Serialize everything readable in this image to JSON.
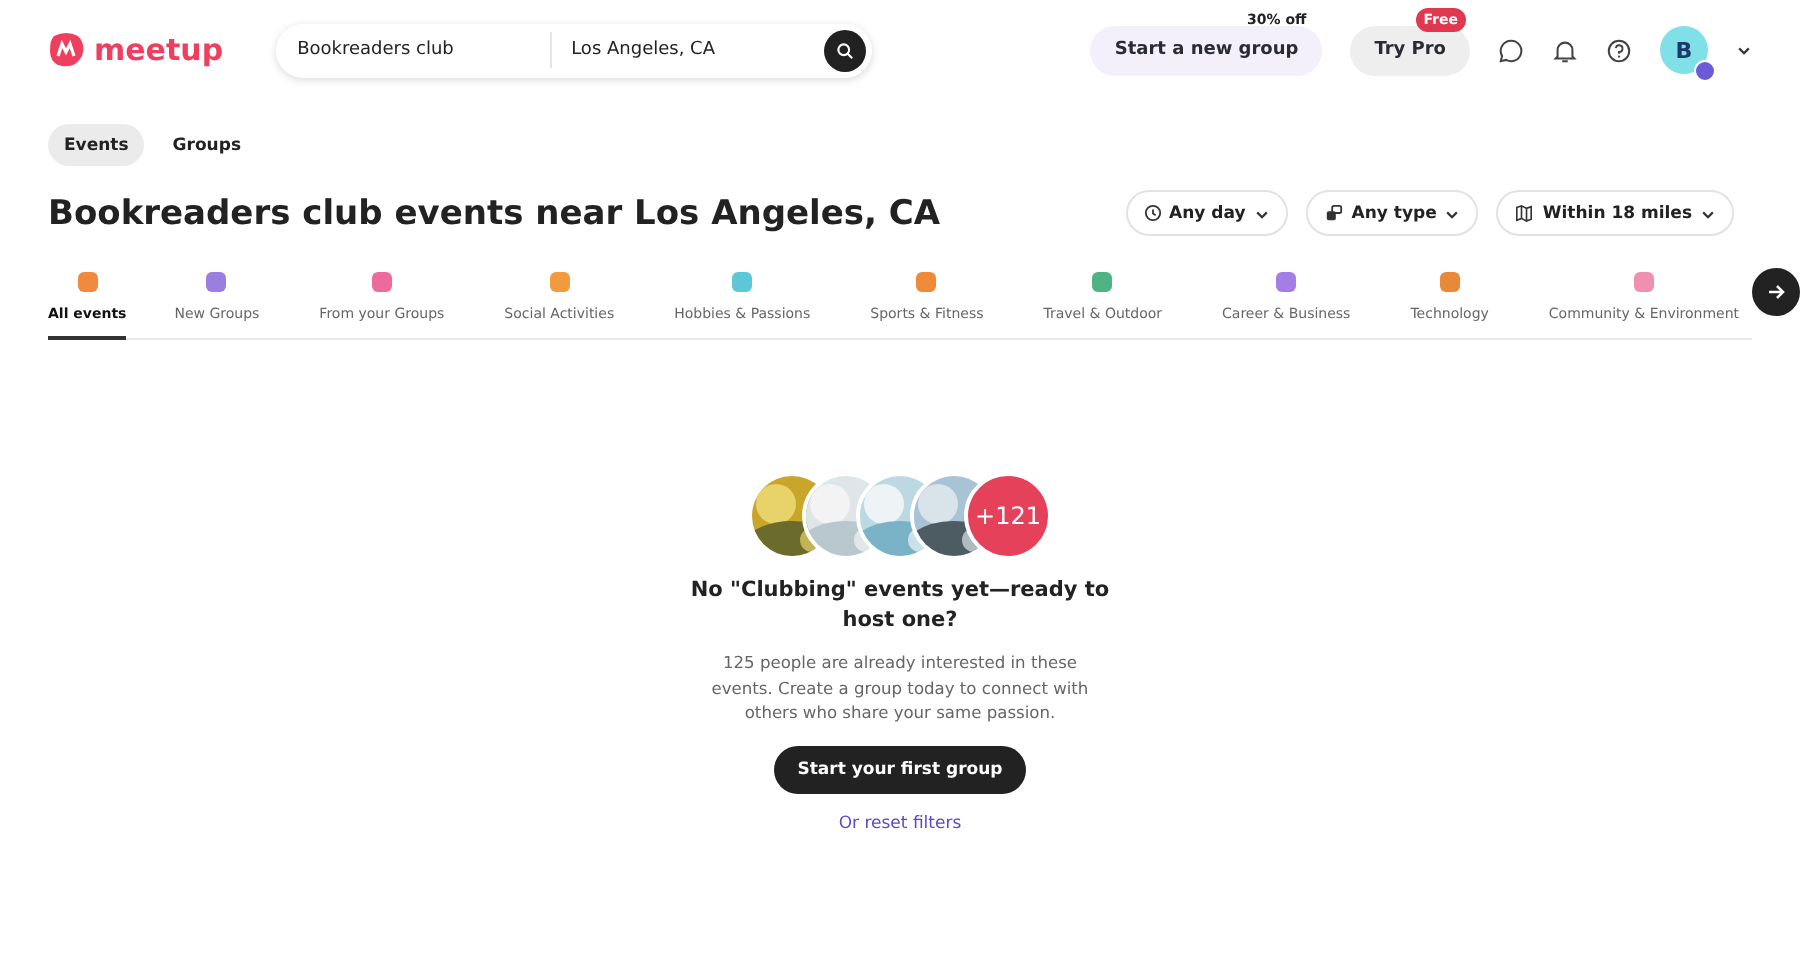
{
  "header": {
    "logo": "meetup",
    "search": {
      "query": "Bookreaders club",
      "location": "Los Angeles, CA"
    },
    "start_group": {
      "label": "Start a new group",
      "badge": "30% off"
    },
    "try_pro": {
      "label": "Try Pro",
      "badge": "Free"
    },
    "avatar": "B"
  },
  "tabs": [
    {
      "label": "Events",
      "selected": true
    },
    {
      "label": "Groups",
      "selected": false
    }
  ],
  "title": "Bookreaders club events near Los Angeles, CA",
  "filters": [
    {
      "label": "Any day",
      "kind": "clock"
    },
    {
      "label": "Any type",
      "kind": "type"
    },
    {
      "label": "Within 18 miles",
      "kind": "map"
    }
  ],
  "categories": [
    {
      "label": "All events",
      "selected": true,
      "color": "#f08a3c"
    },
    {
      "label": "New Groups",
      "selected": false,
      "color": "#9b7fe0"
    },
    {
      "label": "From your Groups",
      "selected": false,
      "color": "#ec6a9c"
    },
    {
      "label": "Social Activities",
      "selected": false,
      "color": "#f19a3e"
    },
    {
      "label": "Hobbies & Passions",
      "selected": false,
      "color": "#5cc7d6"
    },
    {
      "label": "Sports & Fitness",
      "selected": false,
      "color": "#ef8a3a"
    },
    {
      "label": "Travel & Outdoor",
      "selected": false,
      "color": "#4fb384"
    },
    {
      "label": "Career & Business",
      "selected": false,
      "color": "#a57de6"
    },
    {
      "label": "Technology",
      "selected": false,
      "color": "#e8893a"
    },
    {
      "label": "Community & Environment",
      "selected": false,
      "color": "#f08fb0"
    }
  ],
  "empty_state": {
    "more_count": "+121",
    "heading": "No \"Clubbing\" events yet—ready to host one?",
    "text": "125 people are already interested in these events. Create a group today to connect with others who share your same passion.",
    "button": "Start your first group",
    "link": "Or reset filters"
  }
}
